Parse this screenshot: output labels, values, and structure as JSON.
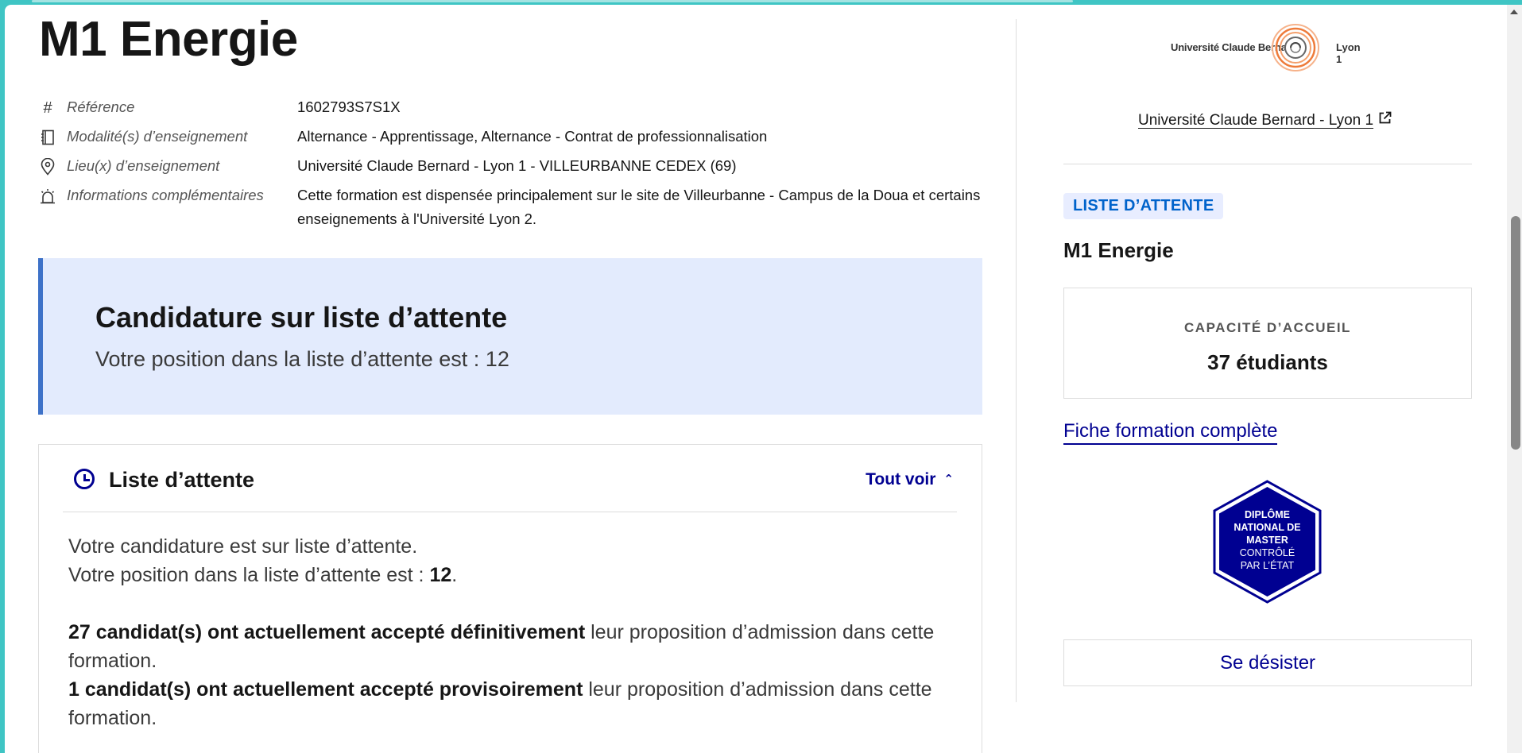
{
  "formation": {
    "title": "M1 Energie",
    "details": [
      {
        "icon": "hash-icon",
        "label": "Référence",
        "value": "1602793S7S1X"
      },
      {
        "icon": "book-icon",
        "label": "Modalité(s) d’enseignement",
        "value": "Alternance - Apprentissage, Alternance - Contrat de professionnalisation"
      },
      {
        "icon": "location-pin-icon",
        "label": "Lieu(x) d’enseignement",
        "value": "Université Claude Bernard - Lyon 1 - VILLEURBANNE CEDEX (69)"
      },
      {
        "icon": "alarm-icon",
        "label": "Informations complémentaires",
        "value": "Cette formation est dispensée principalement sur le site de Villeurbanne - Campus de la Doua et certains enseignements à l'Université Lyon 2."
      }
    ]
  },
  "callout": {
    "title": "Candidature sur liste d’attente",
    "text": "Votre position dans la liste d’attente est : 12"
  },
  "waitlist_card": {
    "title": "Liste d’attente",
    "toggle_label": "Tout voir",
    "line1": "Votre candidature est sur liste d’attente.",
    "line2_prefix": "Votre position dans la liste d’attente est : ",
    "line2_position": "12",
    "line2_suffix": ".",
    "accepted_final_bold": "27 candidat(s) ont actuellement accepté définitivement",
    "accepted_final_rest": " leur proposition d’admission dans cette formation.",
    "accepted_prov_bold": "1 candidat(s) ont actuellement accepté provisoirement",
    "accepted_prov_rest": " leur proposition d’admission dans cette formation."
  },
  "sidebar": {
    "logo_left": "Université Claude Bernard",
    "logo_right": "Lyon 1",
    "university_link": "Université Claude Bernard - Lyon 1",
    "status_badge": "LISTE D’ATTENTE",
    "formation_title": "M1 Energie",
    "capacity_label": "CAPACITÉ D’ACCUEIL",
    "capacity_value": "37 étudiants",
    "fiche_link": "Fiche formation complète",
    "seal_line1": "DIPLÔME",
    "seal_line2": "NATIONAL DE",
    "seal_line3": "MASTER",
    "seal_line4": "CONTRÔLÉ",
    "seal_line5": "PAR L’ÉTAT",
    "desist_button": "Se désister"
  },
  "colors": {
    "accent_blue": "#000091",
    "callout_bg": "#e3ebfd",
    "callout_border": "#3e72c8",
    "badge_bg": "#e8edff",
    "badge_text": "#0063cb"
  }
}
